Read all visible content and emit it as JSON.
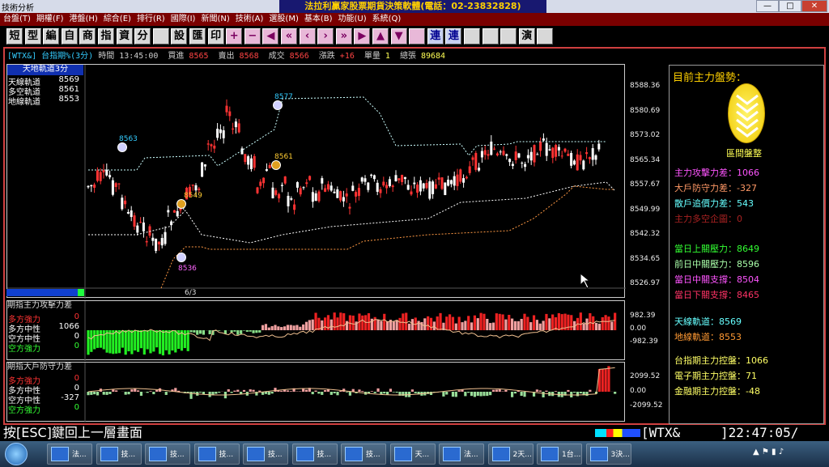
{
  "window": {
    "app_name": "技術分析",
    "title": "法拉利贏家股票期貨決策軟體(電話：02-23832828)",
    "buttons": [
      "—",
      "□",
      "✕"
    ]
  },
  "menu": [
    "台盤(T)",
    "期權(F)",
    "港盤(H)",
    "綜合(E)",
    "排行(R)",
    "國際(I)",
    "新聞(N)",
    "技術(A)",
    "選股(M)",
    "基本(B)",
    "功能(U)",
    "系統(Q)"
  ],
  "toolbar": [
    "短",
    "型",
    "編",
    "自",
    "商",
    "指",
    "資",
    "分",
    "",
    "設",
    "匯",
    "印",
    "+",
    "−",
    "◀",
    "«",
    "‹",
    "›",
    "»",
    "▶",
    "▲",
    "▼",
    "",
    "連",
    "連",
    "",
    "",
    "",
    "演",
    ""
  ],
  "quote": {
    "symbol": "[WTX&]",
    "name": "台指期%(3分)",
    "time_label": "時間",
    "time": "13:45:00",
    "bid_label": "買進",
    "bid": "8565",
    "ask_label": "賣出",
    "ask": "8568",
    "last_label": "成交",
    "last": "8566",
    "chg_label": "漲跌",
    "chg": "+16",
    "vol_label": "單量",
    "vol": "1",
    "total_label": "總張",
    "total": "89684"
  },
  "main_panel": {
    "legend_title": "天地軌道3分",
    "legend": [
      {
        "name": "天線軌道",
        "value": "8569",
        "color": "#ffffff"
      },
      {
        "name": "多空軌道",
        "value": "8561",
        "color": "#ffffff"
      },
      {
        "name": "地線軌道",
        "value": "8553",
        "color": "#ffffff"
      }
    ],
    "date_label": "6/3",
    "y_ticks": [
      "8588.36",
      "8580.69",
      "8573.02",
      "8565.34",
      "8557.67",
      "8549.99",
      "8542.32",
      "8534.65",
      "8526.97"
    ],
    "markers": [
      {
        "label": "8577",
        "color": "#33ccff"
      },
      {
        "label": "8563",
        "color": "#33ccff"
      },
      {
        "label": "8549",
        "color": "#ffcc33"
      },
      {
        "label": "8561",
        "color": "#ffcc33"
      },
      {
        "label": "8536",
        "color": "#ff66ff"
      }
    ]
  },
  "panel2": {
    "title": "期指主力攻擊力差",
    "rows": [
      {
        "name": "多方強力",
        "value": "0",
        "color": "#ff3333"
      },
      {
        "name": "多方中性",
        "value": "1066",
        "color": "#ffffff"
      },
      {
        "name": "空方中性",
        "value": "0",
        "color": "#ffffff"
      },
      {
        "name": "空方強力",
        "value": "0",
        "color": "#33ff33"
      }
    ],
    "y_ticks": [
      "982.39",
      "0.00",
      "-982.39"
    ]
  },
  "panel3": {
    "title": "期指大戶防守力差",
    "rows": [
      {
        "name": "多方強力",
        "value": "0",
        "color": "#ff3333"
      },
      {
        "name": "多方中性",
        "value": "0",
        "color": "#ffffff"
      },
      {
        "name": "空方中性",
        "value": "-327",
        "color": "#ffffff"
      },
      {
        "name": "空方強力",
        "value": "0",
        "color": "#33ff33"
      }
    ],
    "y_ticks": [
      "2099.52",
      "0.00",
      "-2099.52"
    ]
  },
  "right_panel": {
    "heading": "目前主力盤勢：",
    "badge": "區間盤整",
    "items": [
      {
        "text": "主力攻擊力差：1066",
        "color": "#ff55ff"
      },
      {
        "text": "大戶防守力差：-327",
        "color": "#ff9966"
      },
      {
        "text": "散戶追價力差：543",
        "color": "#66ffff"
      },
      {
        "text": "主力多空企圖：0",
        "color": "#aa2222"
      },
      {
        "text": "當日上關壓力：8649",
        "color": "#33ff33"
      },
      {
        "text": "前日中關壓力：8596",
        "color": "#aaffaa"
      },
      {
        "text": "當日中關支撐：8504",
        "color": "#ff55ff"
      },
      {
        "text": "當日下關支撐：8465",
        "color": "#ff3366"
      },
      {
        "text": "天線軌道：8569",
        "color": "#66ffff"
      },
      {
        "text": "地線軌道：8553",
        "color": "#ff9933"
      },
      {
        "text": "台指期主力控盤：1066",
        "color": "#ffff66"
      },
      {
        "text": "電子期主力控盤：71",
        "color": "#ffff66"
      },
      {
        "text": "金融期主力控盤：-48",
        "color": "#ffff66"
      }
    ]
  },
  "status": {
    "hint": "按[ESC]鍵回上一層畫面",
    "symbol": "[WTX&",
    "clock": "]22:47:05/"
  },
  "taskbar": [
    "法...",
    "技...",
    "技...",
    "技...",
    "技...",
    "技...",
    "技...",
    "天...",
    "法...",
    "2天...",
    "1台...",
    "3決..."
  ],
  "colors": {
    "menu_bg": "#7a0000",
    "title_bg": "#181870",
    "title_fg": "#ffd000",
    "up": "#ff3333",
    "down": "#ffffff"
  }
}
